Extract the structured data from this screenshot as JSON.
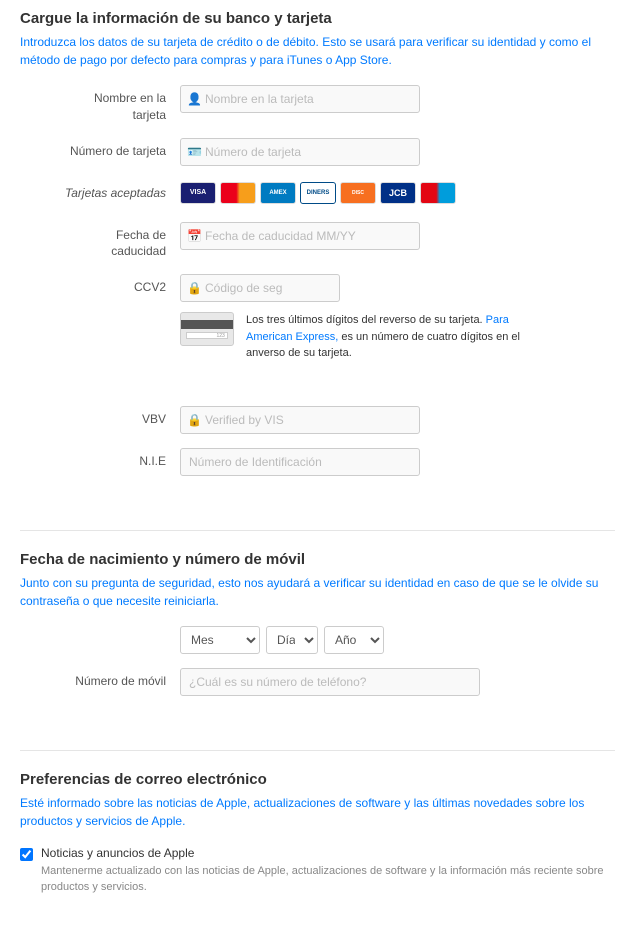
{
  "sections": {
    "bank_card": {
      "title": "Cargue la información de su banco y tarjeta",
      "description_parts": [
        {
          "text": "Introduzca los datos de su tarjeta de crédito o de débito. Esto se usará para ",
          "link": false
        },
        {
          "text": "verificar su identidad y como el método de pago por defecto para compras y para iTunes o App Store.",
          "link": false
        }
      ],
      "description": "Introduzca los datos de su tarjeta de crédito o de débito. Esto se usará para verificar su identidad y como el método de pago por defecto para compras y para iTunes o App Store.",
      "fields": {
        "card_name": {
          "label": "Nombre en la tarjeta",
          "placeholder": "Nombre en la tarjeta"
        },
        "card_number": {
          "label": "Número de tarjeta",
          "placeholder": "Número de tarjeta"
        },
        "accepted_cards_label": "Tarjetas aceptadas",
        "expiry": {
          "label": "Fecha de caducidad",
          "placeholder": "Fecha de caducidad MM/YY"
        },
        "ccv2": {
          "label": "CCV2",
          "placeholder": "Código de seg"
        },
        "ccv2_info": "Los tres últimos dígitos del reverso de su tarjeta. Para American Express, es un número de cuatro dígitos en el anverso de su tarjeta.",
        "ccv2_info_link": "Para American Express,",
        "vbv": {
          "label": "VBV",
          "placeholder": "Verified by VIS"
        },
        "nie": {
          "label": "N.I.E",
          "placeholder": "Número de Identificación"
        }
      },
      "cards": [
        {
          "name": "Visa",
          "class": "card-visa",
          "text": "VISA"
        },
        {
          "name": "MasterCard",
          "class": "card-mc",
          "text": "MC"
        },
        {
          "name": "AmEx",
          "class": "card-amex",
          "text": "AMEX"
        },
        {
          "name": "Diners",
          "class": "card-diners",
          "text": "DINERS"
        },
        {
          "name": "Discover",
          "class": "card-discover",
          "text": "DISC"
        },
        {
          "name": "JCB",
          "class": "card-jcb",
          "text": "JCB"
        },
        {
          "name": "Maestro",
          "class": "card-maestro",
          "text": "MAE"
        }
      ]
    },
    "birthday": {
      "title": "Fecha de nacimiento y número de móvil",
      "description": "Junto con su pregunta de seguridad, esto nos ayudará a verificar su identidad en caso de que se le olvide su contraseña o que necesite reiniciarla.",
      "mes_label": "Mes",
      "dia_label": "Día",
      "ano_label": "Año",
      "phone_label": "Número de móvil",
      "phone_placeholder": "¿Cuál es su número de teléfono?"
    },
    "email_prefs": {
      "title": "Preferencias de correo electrónico",
      "description": "Esté informado sobre las noticias de Apple, actualizaciones de software y las últimas novedades sobre los productos y servicios de Apple.",
      "checkbox_label": "Noticias y anuncios de Apple",
      "checkbox_description": "Mantenerme actualizado con las noticias de Apple, actualizaciones de software y la información más reciente sobre productos y servicios."
    }
  }
}
